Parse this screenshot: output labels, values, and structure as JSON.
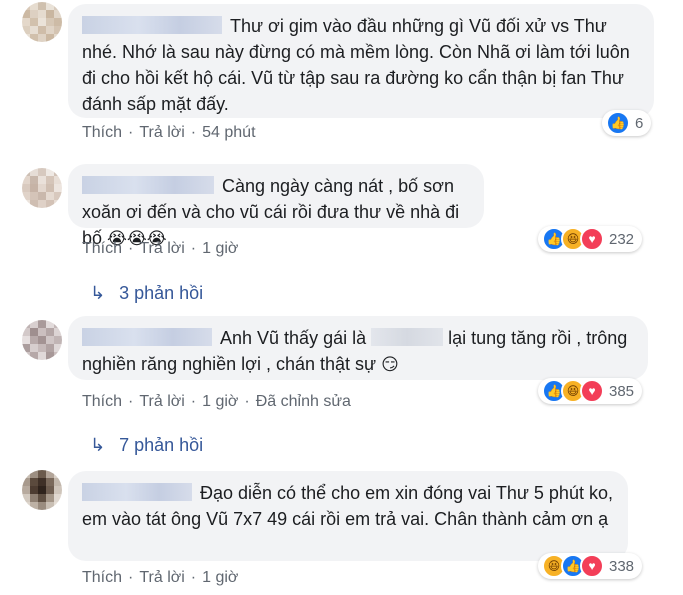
{
  "comments": [
    {
      "text": "Thư ơi gim vào đầu những gì Vũ đối xử vs Thư nhé. Nhớ là sau này đừng có mà mềm lòng. Còn Nhã ơi làm tới luôn đi cho hồi kết hộ cái. Vũ từ tập sau ra đường ko cẩn thận bị fan Thư đánh sấp mặt đấy.",
      "like": "Thích",
      "reply": "Trả lời",
      "time": "54 phút",
      "reaction_count": "6"
    },
    {
      "text": "Càng ngày càng nát , bố sơn xoăn ơi đến và cho vũ cái rồi đưa thư về nhà đi bố",
      "emojis": "😭😭😭",
      "like": "Thích",
      "reply": "Trả lời",
      "time": "1 giờ",
      "reaction_count": "232",
      "replies": "3 phản hồi"
    },
    {
      "text_before": "Anh Vũ thấy gái là",
      "text_after": "lại tung tăng rồi , trông nghiền răng nghiền lợi , chán thật sự",
      "emojis": "😏",
      "like": "Thích",
      "reply": "Trả lời",
      "time": "1 giờ",
      "edited": "Đã chỉnh sửa",
      "reaction_count": "385",
      "replies": "7 phản hồi"
    },
    {
      "text": "Đạo diễn có thể cho em xin đóng vai Thư 5 phút ko, em vào tát ông Vũ 7x7 49 cái rồi em trả vai. Chân thành cảm ơn ạ",
      "like": "Thích",
      "reply": "Trả lời",
      "time": "1 giờ",
      "reaction_count": "338"
    }
  ],
  "icons": {
    "like": "👍",
    "haha": "😆",
    "love": "♥",
    "reply_arrow": "↳"
  },
  "colors": {
    "link": "#365899",
    "bubble": "#f2f3f5",
    "meta": "#606770",
    "like_blue": "#1877f2",
    "love_red": "#f33e58",
    "haha_yellow": "#f7b125"
  }
}
